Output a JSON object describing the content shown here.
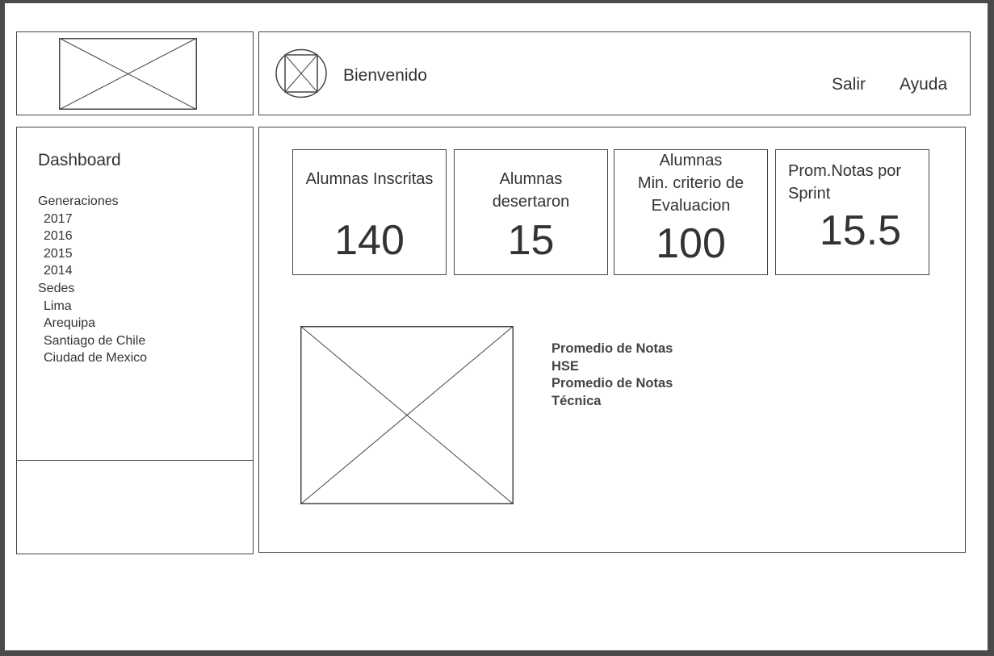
{
  "header": {
    "welcome": "Bienvenido",
    "nav": {
      "exit": "Salir",
      "help": "Ayuda"
    }
  },
  "sidebar": {
    "title": "Dashboard",
    "generations": {
      "heading": "Generaciones",
      "items": [
        "2017",
        "2016",
        "2015",
        "2014"
      ]
    },
    "sedes": {
      "heading": "Sedes",
      "items": [
        "Lima",
        "Arequipa",
        "Santiago de Chile",
        "Ciudad de Mexico"
      ]
    }
  },
  "kpis": [
    {
      "label_lines": [
        "Alumnas Inscritas"
      ],
      "value": "140"
    },
    {
      "label_lines": [
        "Alumnas",
        "desertaron"
      ],
      "value": "15"
    },
    {
      "label_lines": [
        "Alumnas",
        "Min. criterio de",
        "Evaluacion"
      ],
      "value": "100"
    },
    {
      "label_lines": [
        "Prom.Notas por",
        "Sprint"
      ],
      "value": "15.5"
    }
  ],
  "legend": [
    "Promedio de Notas",
    "HSE",
    "Promedio de Notas",
    "Técnica"
  ],
  "icons": {
    "logo": "image-placeholder-icon",
    "avatar": "user-avatar-icon",
    "chart": "image-placeholder-icon"
  }
}
